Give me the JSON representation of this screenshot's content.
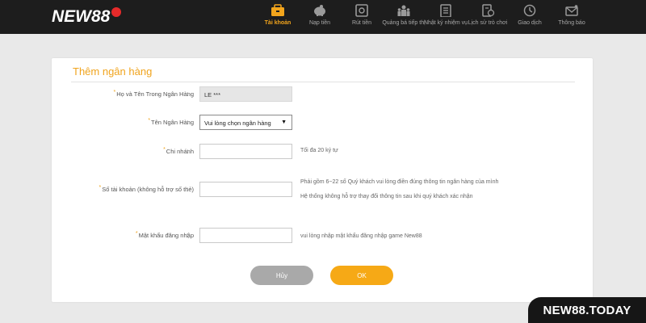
{
  "header": {
    "logo_text": "NEW88",
    "nav": [
      {
        "label": "Tài khoản",
        "icon": "wallet-icon",
        "active": true
      },
      {
        "label": "Nạp tiền",
        "icon": "piggy-bank-icon",
        "active": false
      },
      {
        "label": "Rút tiền",
        "icon": "safe-icon",
        "active": false
      },
      {
        "label": "Quảng bá tiếp thị",
        "icon": "people-icon",
        "active": false
      },
      {
        "label": "Nhật ký nhiệm vụ",
        "icon": "clipboard-icon",
        "active": false
      },
      {
        "label": "Lịch sử trò chơi",
        "icon": "history-doc-icon",
        "active": false
      },
      {
        "label": "Giao dịch",
        "icon": "clock-icon",
        "active": false
      },
      {
        "label": "Thông báo",
        "icon": "mail-icon",
        "active": false
      }
    ]
  },
  "form": {
    "title": "Thêm ngân hàng",
    "account_holder": {
      "label": "Họ và Tên Trong Ngân Hàng",
      "value": "LE ***"
    },
    "bank_name": {
      "label": "Tên Ngân Hàng",
      "selected": "Vui lòng chọn ngân hàng"
    },
    "branch": {
      "label": "Chi nhánh",
      "value": "",
      "hint": "Tối đa 20 ký tự"
    },
    "account_number": {
      "label": "Số tài khoản (không hỗ trợ số thẻ)",
      "value": "",
      "hint_1": "Phải gồm 6~22 số Quý khách vui lòng điền đúng thông tin ngân hàng của mình",
      "hint_2": "Hệ thống không hỗ trợ thay đổi thông tin sau khi quý khách xác nhận"
    },
    "password": {
      "label": "Mật khẩu đăng nhập",
      "value": "",
      "hint": "vui lòng nhập mật khẩu đăng nhập game New88"
    },
    "cancel_label": "Hủy",
    "ok_label": "OK"
  },
  "watermark": {
    "text": "NEW88.TODAY"
  },
  "colors": {
    "accent": "#f3a51c",
    "topbar": "#1d1d1d",
    "cancel": "#a9a9a9",
    "ok": "#f6a916"
  }
}
